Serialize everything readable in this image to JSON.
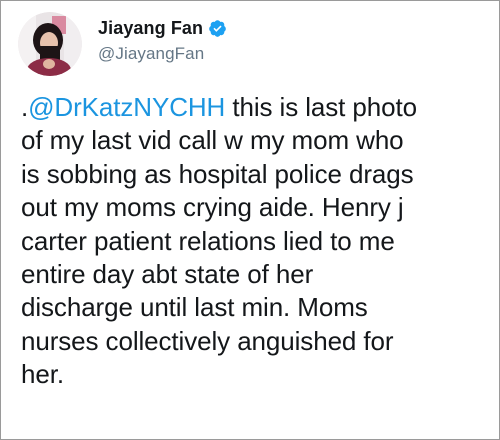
{
  "user": {
    "display_name": "Jiayang Fan",
    "handle": "@JiayangFan",
    "verified": true,
    "avatar_icon": "profile-photo"
  },
  "tweet": {
    "prefix": ".",
    "mention": "@DrKatzNYCHH",
    "lines": [
      " this is last photo",
      "of my last vid call w my mom who",
      "is sobbing as hospital police drags",
      "out my moms crying aide. Henry j",
      "carter patient relations lied to me",
      "entire day abt state of her",
      "discharge until last min. Moms",
      "nurses collectively anguished for",
      "her."
    ]
  },
  "colors": {
    "mention": "#1b95e0",
    "verified_badge": "#1da1f2",
    "handle": "#657786",
    "text": "#14171a"
  }
}
